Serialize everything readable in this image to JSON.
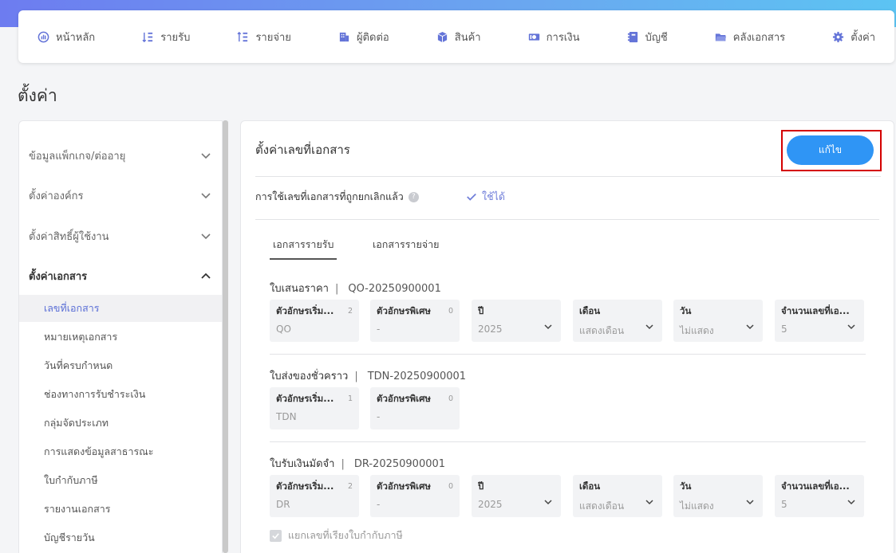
{
  "nav": [
    {
      "label": "หน้าหลัก",
      "icon": "dashboard-icon"
    },
    {
      "label": "รายรับ",
      "icon": "income-icon"
    },
    {
      "label": "รายจ่าย",
      "icon": "expense-icon"
    },
    {
      "label": "ผู้ติดต่อ",
      "icon": "contacts-icon"
    },
    {
      "label": "สินค้า",
      "icon": "product-icon"
    },
    {
      "label": "การเงิน",
      "icon": "finance-icon"
    },
    {
      "label": "บัญชี",
      "icon": "accounting-icon"
    },
    {
      "label": "คลังเอกสาร",
      "icon": "folder-icon"
    },
    {
      "label": "ตั้งค่า",
      "icon": "gear-icon"
    }
  ],
  "page_title": "ตั้งค่า",
  "sidebar": {
    "groups": [
      {
        "label": "ข้อมูลแพ็กเกจ/ต่ออายุ",
        "expanded": false
      },
      {
        "label": "ตั้งค่าองค์กร",
        "expanded": false
      },
      {
        "label": "ตั้งค่าสิทธิ์ผู้ใช้งาน",
        "expanded": false
      },
      {
        "label": "ตั้งค่าเอกสาร",
        "expanded": true
      }
    ],
    "items": [
      {
        "label": "เลขที่เอกสาร",
        "active": true
      },
      {
        "label": "หมายเหตุเอกสาร"
      },
      {
        "label": "วันที่ครบกำหนด"
      },
      {
        "label": "ช่องทางการรับชำระเงิน"
      },
      {
        "label": "กลุ่มจัดประเภท"
      },
      {
        "label": "การแสดงข้อมูลสาธารณะ"
      },
      {
        "label": "ใบกำกับภาษี"
      },
      {
        "label": "รายงานเอกสาร"
      },
      {
        "label": "บัญชีรายวัน"
      }
    ]
  },
  "main": {
    "title": "ตั้งค่าเลขที่เอกสาร",
    "edit_label": "แก้ไข",
    "option_label": "การใช้เลขที่เอกสารที่ถูกยกเลิกแล้ว",
    "option_value": "ใช้ได้",
    "tabs": [
      {
        "label": "เอกสารรายรับ",
        "active": true
      },
      {
        "label": "เอกสารรายจ่าย"
      }
    ],
    "docs": [
      {
        "name": "ใบเสนอราคา",
        "code": "QO-20250900001",
        "fields": [
          {
            "label": "ตัวอักษรเริ่ม...",
            "count": "2",
            "value": "QO"
          },
          {
            "label": "ตัวอักษรพิเศษ",
            "count": "0",
            "value": "-"
          },
          {
            "label": "ปี",
            "value": "2025",
            "dropdown": true
          },
          {
            "label": "เดือน",
            "value": "แสดงเดือน",
            "dropdown": true
          },
          {
            "label": "วัน",
            "value": "ไม่แสดง",
            "dropdown": true
          },
          {
            "label": "จำนวนเลขที่เอ...",
            "value": "5",
            "dropdown": true
          }
        ]
      },
      {
        "name": "ใบส่งของชั่วคราว",
        "code": "TDN-20250900001",
        "fields": [
          {
            "label": "ตัวอักษรเริ่ม...",
            "count": "1",
            "value": "TDN"
          },
          {
            "label": "ตัวอักษรพิเศษ",
            "count": "0",
            "value": "-"
          }
        ]
      },
      {
        "name": "ใบรับเงินมัดจำ",
        "code": "DR-20250900001",
        "fields": [
          {
            "label": "ตัวอักษรเริ่ม...",
            "count": "2",
            "value": "DR"
          },
          {
            "label": "ตัวอักษรพิเศษ",
            "count": "0",
            "value": "-"
          },
          {
            "label": "ปี",
            "value": "2025",
            "dropdown": true
          },
          {
            "label": "เดือน",
            "value": "แสดงเดือน",
            "dropdown": true
          },
          {
            "label": "วัน",
            "value": "ไม่แสดง",
            "dropdown": true
          },
          {
            "label": "จำนวนเลขที่เอ...",
            "value": "5",
            "dropdown": true
          }
        ]
      }
    ],
    "checkbox_label": "แยกเลขที่เรียงใบกำกับภาษี"
  },
  "colors": {
    "accent": "#2f95f5",
    "nav_icon": "#6474d8",
    "highlight": "#d40000"
  }
}
